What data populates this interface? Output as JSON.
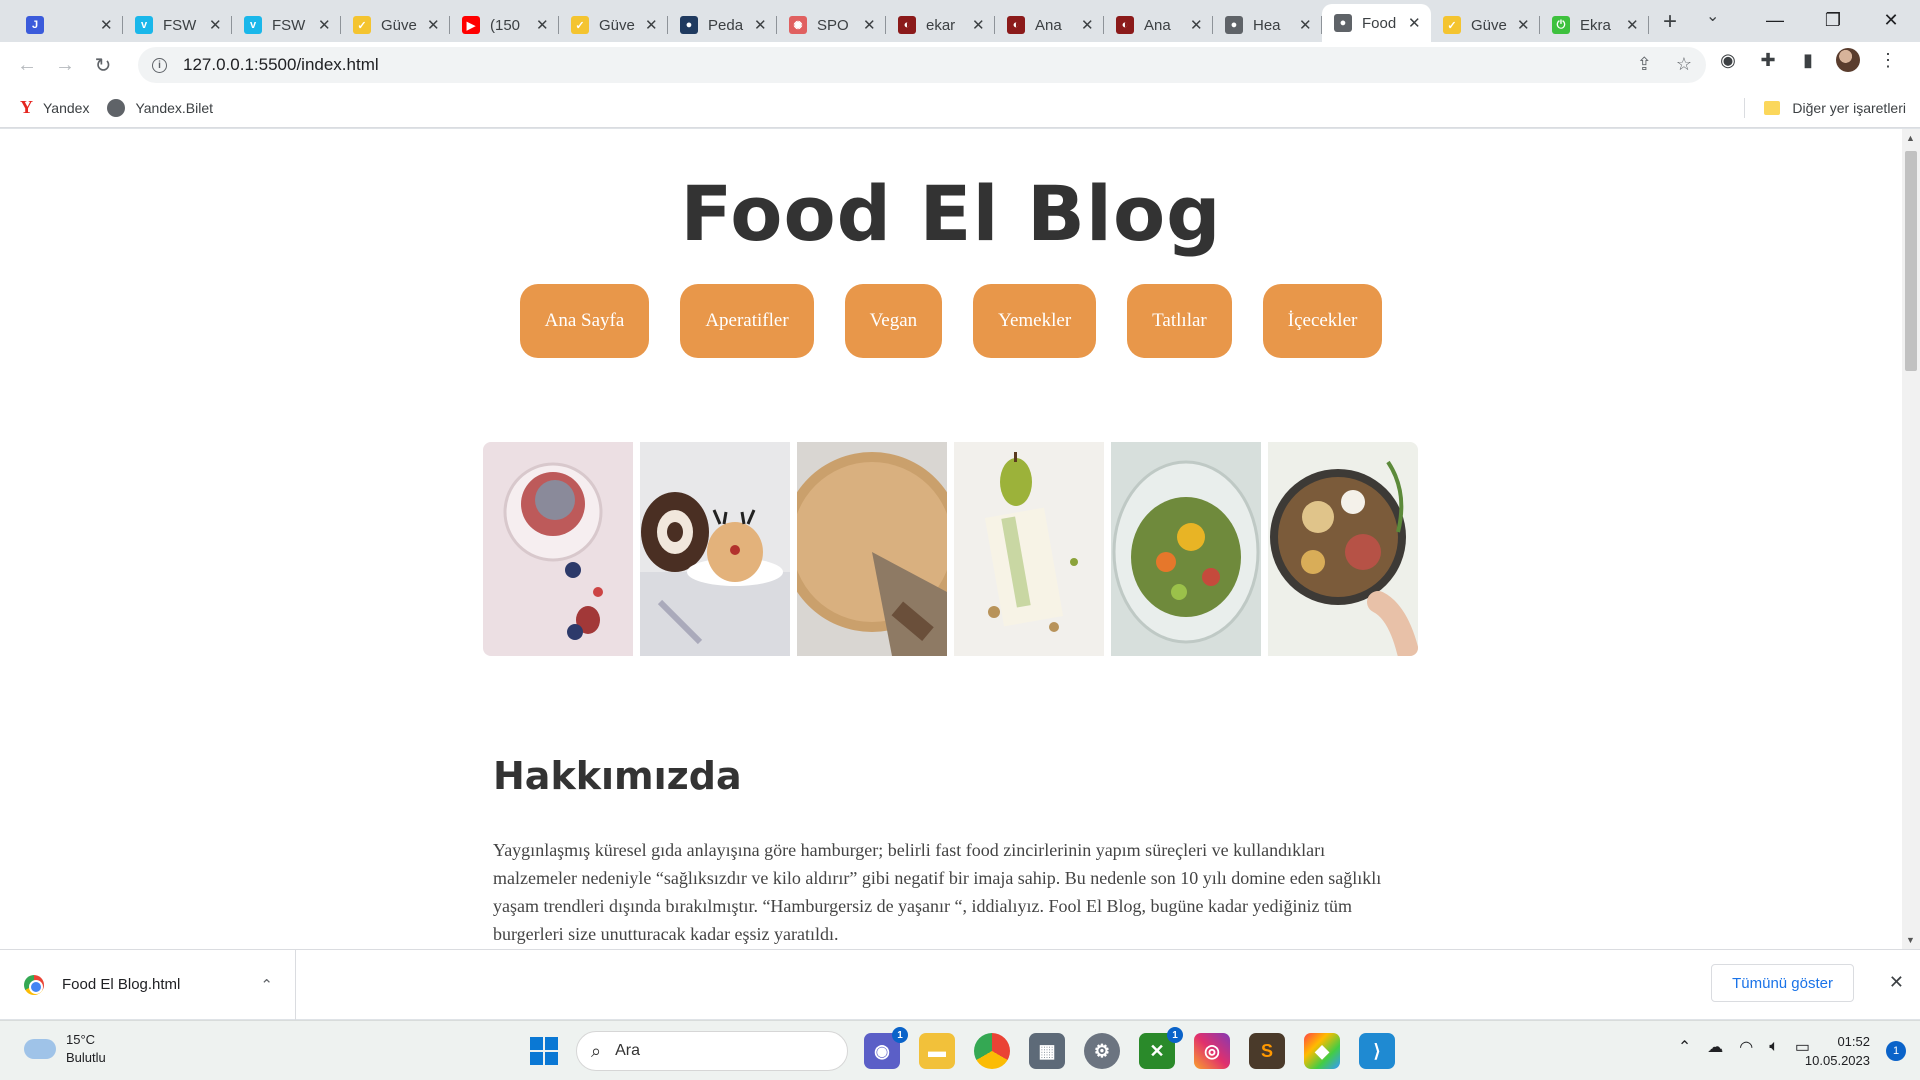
{
  "browser": {
    "tabs": [
      {
        "title": "",
        "favicon": "j-icon",
        "color": "#3b5bdb"
      },
      {
        "title": "FSW",
        "favicon": "vimeo-icon",
        "color": "#1ab7ea"
      },
      {
        "title": "FSW",
        "favicon": "vimeo-icon",
        "color": "#1ab7ea"
      },
      {
        "title": "Güve",
        "favicon": "check-icon",
        "color": "#f4c430"
      },
      {
        "title": "(150",
        "favicon": "youtube-icon",
        "color": "#ff0000"
      },
      {
        "title": "Güve",
        "favicon": "check-icon",
        "color": "#f4c430"
      },
      {
        "title": "Peda",
        "favicon": "circle-icon",
        "color": "#1f3a5f"
      },
      {
        "title": "SPO",
        "favicon": "seal-icon",
        "color": "#e06060"
      },
      {
        "title": "ekar",
        "favicon": "slot-icon",
        "color": "#8b1a1a"
      },
      {
        "title": "Ana",
        "favicon": "slot-icon",
        "color": "#8b1a1a"
      },
      {
        "title": "Ana",
        "favicon": "slot-icon",
        "color": "#8b1a1a"
      },
      {
        "title": "Hea",
        "favicon": "globe-icon",
        "color": "#5f6368"
      },
      {
        "title": "Food",
        "favicon": "globe-icon",
        "color": "#5f6368",
        "active": true
      },
      {
        "title": "Güve",
        "favicon": "check-icon",
        "color": "#f4c430"
      },
      {
        "title": "Ekra",
        "favicon": "power-icon",
        "color": "#3ec13e"
      }
    ],
    "url": "127.0.0.1:5500/index.html",
    "bookmarks": [
      {
        "label": "Yandex",
        "icon": "yandex-icon"
      },
      {
        "label": "Yandex.Bilet",
        "icon": "globe-icon"
      }
    ],
    "other_bookmarks": "Diğer yer işaretleri"
  },
  "page": {
    "title": "Food El Blog",
    "nav": [
      "Ana Sayfa",
      "Aperatifler",
      "Vegan",
      "Yemekler",
      "Tatlılar",
      "İçecekler"
    ],
    "accent": "#e8974a",
    "gallery": [
      "chia-pudding-jar",
      "reindeer-dessert",
      "pie-slice",
      "pear-dessert",
      "salad-bowl",
      "veggie-bowl"
    ],
    "about": {
      "heading": "Hakkımızda",
      "text": "Yaygınlaşmış küresel gıda anlayışına göre hamburger; belirli fast food zincirlerinin yapım süreçleri ve kullandıkları malzemeler nedeniyle “sağlıksızdır ve kilo aldırır” gibi negatif bir imaja sahip. Bu nedenle son 10 yılı domine eden sağlıklı yaşam trendleri dışında bırakılmıştır. “Hamburgersiz de yaşanır “, iddialıyız. Fool El Blog, bugüne kadar yediğiniz tüm burgerleri size unutturacak kadar eşsiz yaratıldı."
    }
  },
  "downloads": {
    "file": "Food El Blog.html",
    "show_all": "Tümünü göster"
  },
  "taskbar": {
    "weather_temp": "15°C",
    "weather_desc": "Bulutlu",
    "search_placeholder": "Ara",
    "time": "01:52",
    "date": "10.05.2023",
    "notifications": "1",
    "app_badges": {
      "chat": "1",
      "xbox": "1"
    }
  }
}
